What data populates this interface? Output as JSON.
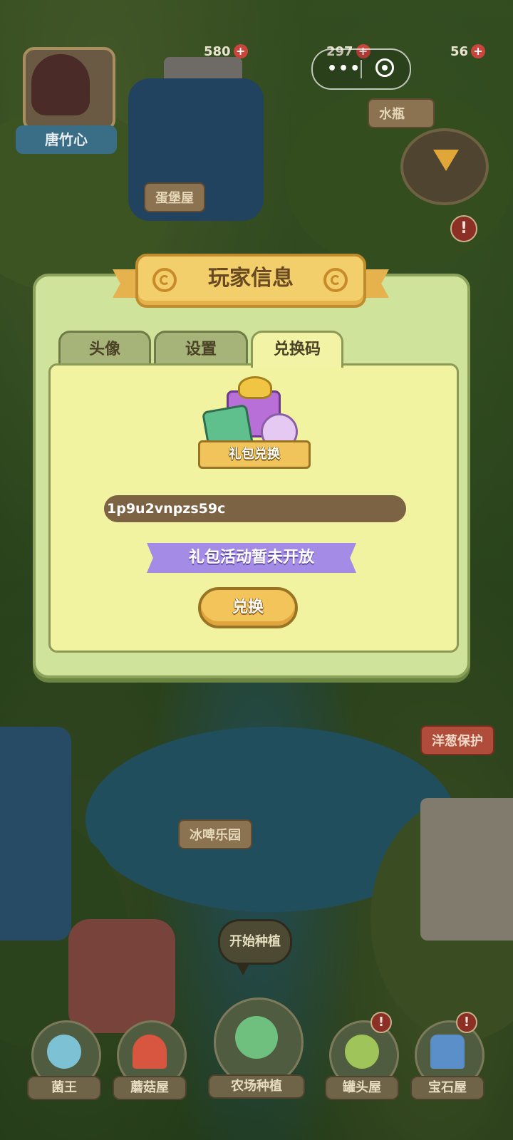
{
  "hud": {
    "coins": "580",
    "coins_plus": "+",
    "gems": "297",
    "gems_plus": "+",
    "energy": "56",
    "energy_plus": "+",
    "capsule_more": "•••",
    "player_name": "唐竹心"
  },
  "map_labels": {
    "egg_house": "蛋堡屋",
    "water_bottle": "水瓶",
    "ice_park": "冰啤乐园",
    "insurance": "洋葱保护"
  },
  "alerts": {
    "mark": "!"
  },
  "modal": {
    "title": "玩家信息",
    "tabs": [
      "头像",
      "设置",
      "兑换码"
    ],
    "active_tab": "兑换码",
    "gift_banner": "礼包兑换",
    "code_value": "1p9u2vnpzs59c",
    "status": "礼包活动暂未开放",
    "redeem_label": "兑换"
  },
  "bottom_nav": {
    "bubble": "开始种植",
    "items": [
      "菌王",
      "蘑菇屋",
      "农场种植",
      "罐头屋",
      "宝石屋"
    ]
  },
  "colors": {
    "modal_bg": "#cfe39a",
    "panel_bg": "#f1f3a1",
    "title_plate": "#f2cf6b",
    "status_banner": "#a38be6",
    "redeem_button": "#f3c45a",
    "code_field": "#7b6344"
  }
}
